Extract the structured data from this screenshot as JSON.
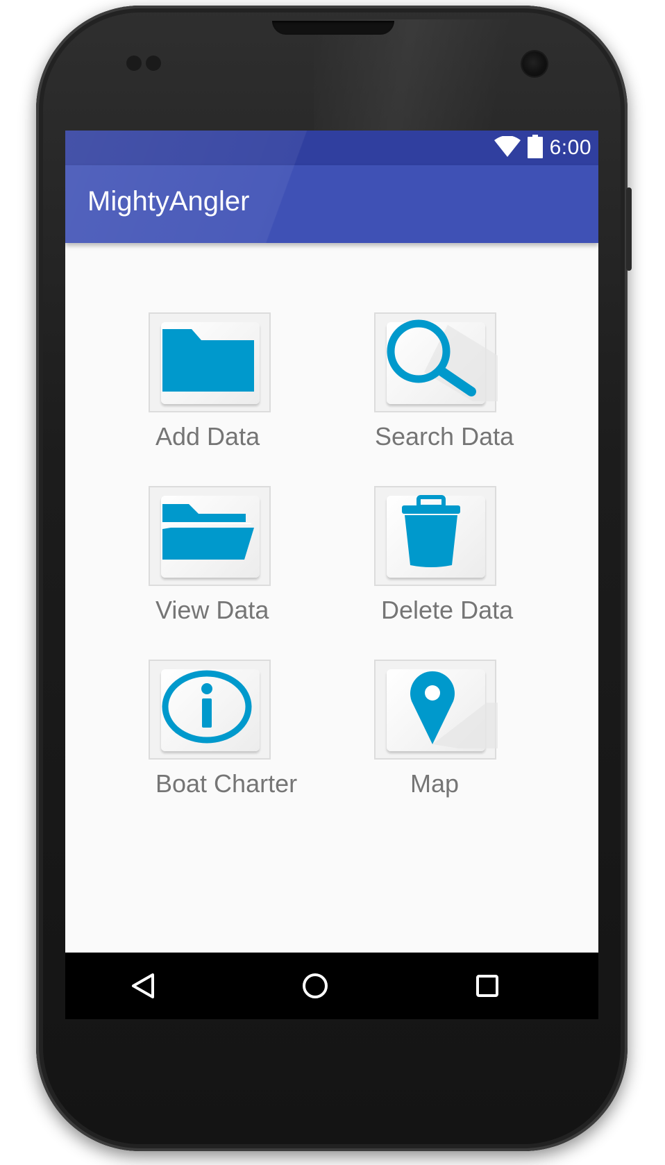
{
  "status_bar": {
    "time": "6:00",
    "icons": [
      "wifi-icon",
      "battery-icon"
    ]
  },
  "app_bar": {
    "title": "MightyAngler"
  },
  "menu": {
    "items": [
      {
        "label": "Add Data",
        "icon": "folder-icon"
      },
      {
        "label": "Search Data",
        "icon": "search-icon"
      },
      {
        "label": "View Data",
        "icon": "folder-open-icon"
      },
      {
        "label": "Delete Data",
        "icon": "trash-icon"
      },
      {
        "label": "Boat Charter",
        "icon": "info-icon"
      },
      {
        "label": "Map",
        "icon": "map-pin-icon"
      }
    ]
  },
  "nav_bar": {
    "buttons": [
      "back-icon",
      "home-icon",
      "recents-icon"
    ]
  },
  "colors": {
    "status_bar": "#303f9f",
    "app_bar": "#3f51b5",
    "icon_blue": "#0099cc",
    "label_gray": "#757575",
    "background": "#fafafa"
  }
}
